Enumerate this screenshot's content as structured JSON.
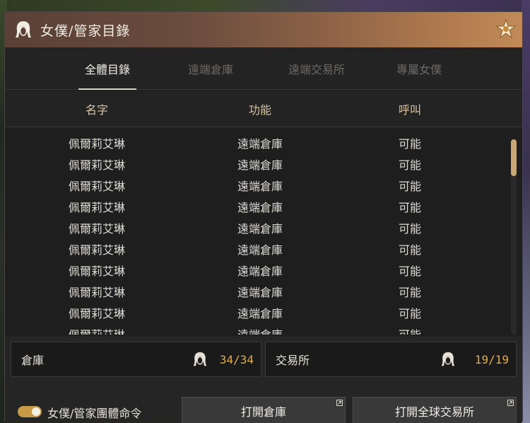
{
  "window": {
    "title": "女僕/管家目錄"
  },
  "tabs": [
    {
      "label": "全體目錄",
      "active": true
    },
    {
      "label": "遠端倉庫",
      "active": false
    },
    {
      "label": "遠端交易所",
      "active": false
    },
    {
      "label": "專屬女僕",
      "active": false
    }
  ],
  "columns": {
    "name": "名字",
    "function": "功能",
    "call": "呼叫"
  },
  "rows": [
    {
      "name": "佩爾莉艾琳",
      "function": "遠端倉庫",
      "call": "可能"
    },
    {
      "name": "佩爾莉艾琳",
      "function": "遠端倉庫",
      "call": "可能"
    },
    {
      "name": "佩爾莉艾琳",
      "function": "遠端倉庫",
      "call": "可能"
    },
    {
      "name": "佩爾莉艾琳",
      "function": "遠端倉庫",
      "call": "可能"
    },
    {
      "name": "佩爾莉艾琳",
      "function": "遠端倉庫",
      "call": "可能"
    },
    {
      "name": "佩爾莉艾琳",
      "function": "遠端倉庫",
      "call": "可能"
    },
    {
      "name": "佩爾莉艾琳",
      "function": "遠端倉庫",
      "call": "可能"
    },
    {
      "name": "佩爾莉艾琳",
      "function": "遠端倉庫",
      "call": "可能"
    },
    {
      "name": "佩爾莉艾琳",
      "function": "遠端倉庫",
      "call": "可能"
    },
    {
      "name": "佩爾莉艾琳",
      "function": "遠端倉庫",
      "call": "可能"
    }
  ],
  "footer": {
    "warehouse_label": "倉庫",
    "warehouse_count": "34/34",
    "market_label": "交易所",
    "market_count": "19/19",
    "group_command_label": "女僕/管家團體命令",
    "group_command_on": true,
    "open_warehouse_label": "打開倉庫",
    "open_market_label": "打開全球交易所"
  },
  "icons": {
    "title": "maid-head-icon",
    "badge": "emblem-star-icon",
    "stat": "maid-head-icon",
    "button_corner": "expand-arrow-icon"
  },
  "colors": {
    "accent": "#e0ac4a",
    "header_text": "#d9c4a0",
    "toggle": "#c79a48",
    "scrollbar": "#c9a67a"
  }
}
